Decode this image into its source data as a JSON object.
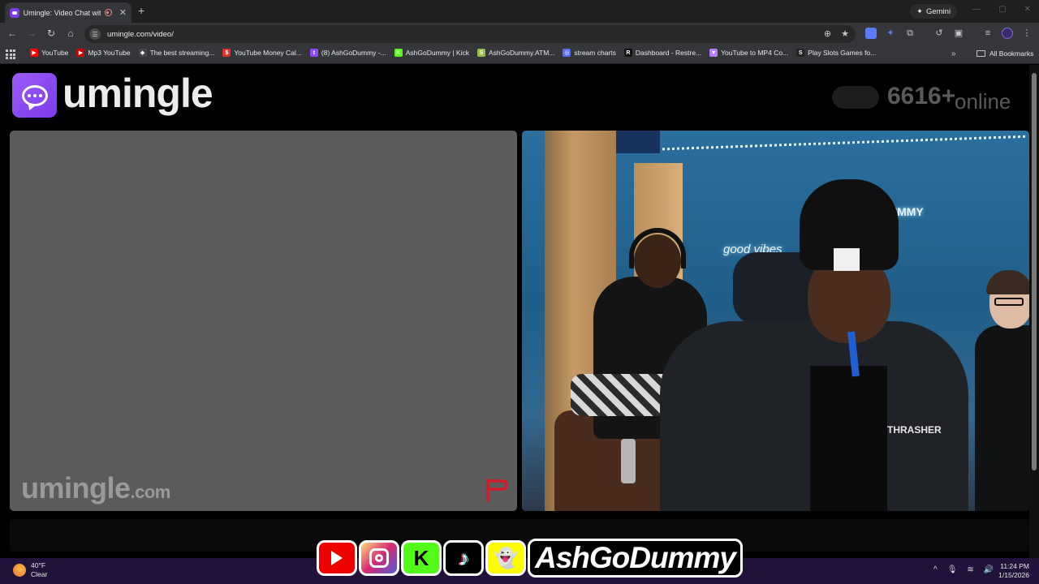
{
  "browser": {
    "tab_title": "Umingle: Video Chat with S",
    "gemini_label": "Gemini",
    "url": "umingle.com/video/"
  },
  "bookmarks": [
    {
      "label": "YouTube",
      "color": "#ff0000",
      "glyph": "▶"
    },
    {
      "label": "Mp3 YouTube",
      "color": "#cc0000",
      "glyph": "▶"
    },
    {
      "label": "The best streaming...",
      "color": "#444444",
      "glyph": "◆"
    },
    {
      "label": "YouTube Money Cal...",
      "color": "#d9342b",
      "glyph": "$"
    },
    {
      "label": "(8) AshGoDummy -...",
      "color": "#9146ff",
      "glyph": "t"
    },
    {
      "label": "AshGoDummy | Kick",
      "color": "#53fc18",
      "glyph": "K"
    },
    {
      "label": "AshGoDummy.ATM...",
      "color": "#95bf47",
      "glyph": "S"
    },
    {
      "label": "stream charts",
      "color": "#5b6cff",
      "glyph": "◎"
    },
    {
      "label": "Dashboard - Restre...",
      "color": "#111111",
      "glyph": "R"
    },
    {
      "label": "YouTube to MP4 Co...",
      "color": "#b77dff",
      "glyph": "▼"
    },
    {
      "label": "Play Slots Games fo...",
      "color": "#222222",
      "glyph": "S"
    }
  ],
  "all_bookmarks_label": "All Bookmarks",
  "page": {
    "logo_text": "umingle",
    "online_count": "6616+",
    "online_label": "online",
    "watermark_main": "umingle",
    "watermark_suffix": ".com",
    "neon_text": "good vibes",
    "neon_sign": "UMMY",
    "shirt_brand": "THRASHER"
  },
  "overlay": {
    "handle": "AshGoDummy",
    "icons": [
      "youtube-icon",
      "instagram-icon",
      "kick-icon",
      "tiktok-icon",
      "snapchat-icon"
    ]
  },
  "taskbar": {
    "temperature": "40°F",
    "condition": "Clear",
    "time": "11:24 PM",
    "date": "1/15/2026"
  },
  "colors": {
    "brand_purple": "#8b5cf6",
    "panel_gray": "#5b5b5b",
    "red_flag": "#d11a2a"
  }
}
